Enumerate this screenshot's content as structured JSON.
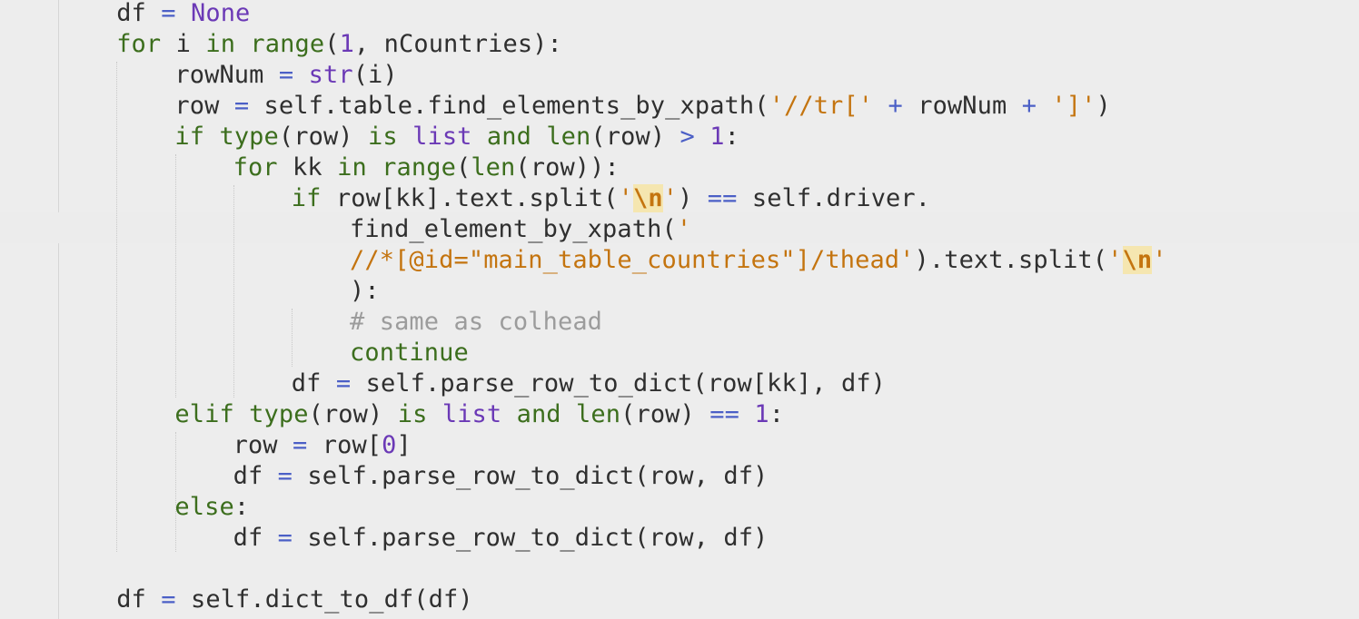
{
  "editor": {
    "language": "python",
    "lines": [
      {
        "indent": "    ",
        "tokens": [
          [
            "id",
            "df"
          ],
          [
            "p",
            " "
          ],
          [
            "op",
            "="
          ],
          [
            "p",
            " "
          ],
          [
            "cls",
            "None"
          ]
        ]
      },
      {
        "indent": "    ",
        "tokens": [
          [
            "kw",
            "for"
          ],
          [
            "p",
            " i "
          ],
          [
            "kw",
            "in"
          ],
          [
            "p",
            " "
          ],
          [
            "bi",
            "range"
          ],
          [
            "p",
            "("
          ],
          [
            "num",
            "1"
          ],
          [
            "p",
            ", nCountries):"
          ]
        ]
      },
      {
        "indent": "        ",
        "tokens": [
          [
            "id",
            "rowNum"
          ],
          [
            "p",
            " "
          ],
          [
            "op",
            "="
          ],
          [
            "p",
            " "
          ],
          [
            "cls",
            "str"
          ],
          [
            "p",
            "(i)"
          ]
        ]
      },
      {
        "indent": "        ",
        "tokens": [
          [
            "id",
            "row"
          ],
          [
            "p",
            " "
          ],
          [
            "op",
            "="
          ],
          [
            "p",
            " self.table.find_elements_by_xpath("
          ],
          [
            "str",
            "'//tr['"
          ],
          [
            "p",
            " "
          ],
          [
            "op",
            "+"
          ],
          [
            "p",
            " rowNum "
          ],
          [
            "op",
            "+"
          ],
          [
            "p",
            " "
          ],
          [
            "str",
            "']'"
          ],
          [
            "p",
            ")"
          ]
        ]
      },
      {
        "indent": "        ",
        "tokens": [
          [
            "kw",
            "if"
          ],
          [
            "p",
            " "
          ],
          [
            "bi",
            "type"
          ],
          [
            "p",
            "(row) "
          ],
          [
            "kw",
            "is"
          ],
          [
            "p",
            " "
          ],
          [
            "cls",
            "list"
          ],
          [
            "p",
            " "
          ],
          [
            "kw",
            "and"
          ],
          [
            "p",
            " "
          ],
          [
            "bi",
            "len"
          ],
          [
            "p",
            "(row) "
          ],
          [
            "op",
            ">"
          ],
          [
            "p",
            " "
          ],
          [
            "num",
            "1"
          ],
          [
            "p",
            ":"
          ]
        ]
      },
      {
        "indent": "            ",
        "tokens": [
          [
            "kw",
            "for"
          ],
          [
            "p",
            " kk "
          ],
          [
            "kw",
            "in"
          ],
          [
            "p",
            " "
          ],
          [
            "bi",
            "range"
          ],
          [
            "p",
            "("
          ],
          [
            "bi",
            "len"
          ],
          [
            "p",
            "(row)):"
          ]
        ]
      },
      {
        "indent": "                ",
        "tokens": [
          [
            "kw",
            "if"
          ],
          [
            "p",
            " row[kk].text.split("
          ],
          [
            "str",
            "'"
          ],
          [
            "esc",
            "\\n"
          ],
          [
            "str",
            "'"
          ],
          [
            "p",
            ") "
          ],
          [
            "op",
            "=="
          ],
          [
            "p",
            " self.driver."
          ]
        ]
      },
      {
        "indent": "                    ",
        "tokens": [
          [
            "p",
            "find_element_by_xpath("
          ],
          [
            "str",
            "'"
          ]
        ]
      },
      {
        "indent": "                    ",
        "tokens": [
          [
            "str",
            "//*[@id=\"main_table_countries\"]/thead'"
          ],
          [
            "p",
            ").text.split("
          ],
          [
            "str",
            "'"
          ],
          [
            "esc",
            "\\n"
          ],
          [
            "str",
            "'"
          ]
        ]
      },
      {
        "indent": "                    ",
        "tokens": [
          [
            "p",
            "):"
          ]
        ]
      },
      {
        "indent": "                    ",
        "tokens": [
          [
            "cmt",
            "# same as colhead"
          ]
        ]
      },
      {
        "indent": "                    ",
        "tokens": [
          [
            "kw",
            "continue"
          ]
        ]
      },
      {
        "indent": "                ",
        "tokens": [
          [
            "id",
            "df"
          ],
          [
            "p",
            " "
          ],
          [
            "op",
            "="
          ],
          [
            "p",
            " self.parse_row_to_dict(row[kk], df)"
          ]
        ]
      },
      {
        "indent": "        ",
        "tokens": [
          [
            "kw",
            "elif"
          ],
          [
            "p",
            " "
          ],
          [
            "bi",
            "type"
          ],
          [
            "p",
            "(row) "
          ],
          [
            "kw",
            "is"
          ],
          [
            "p",
            " "
          ],
          [
            "cls",
            "list"
          ],
          [
            "p",
            " "
          ],
          [
            "kw",
            "and"
          ],
          [
            "p",
            " "
          ],
          [
            "bi",
            "len"
          ],
          [
            "p",
            "(row) "
          ],
          [
            "op",
            "=="
          ],
          [
            "p",
            " "
          ],
          [
            "num",
            "1"
          ],
          [
            "p",
            ":"
          ]
        ]
      },
      {
        "indent": "            ",
        "tokens": [
          [
            "id",
            "row"
          ],
          [
            "p",
            " "
          ],
          [
            "op",
            "="
          ],
          [
            "p",
            " row["
          ],
          [
            "num",
            "0"
          ],
          [
            "p",
            "]"
          ]
        ]
      },
      {
        "indent": "            ",
        "tokens": [
          [
            "id",
            "df"
          ],
          [
            "p",
            " "
          ],
          [
            "op",
            "="
          ],
          [
            "p",
            " self.parse_row_to_dict(row, df)"
          ]
        ]
      },
      {
        "indent": "        ",
        "tokens": [
          [
            "kw",
            "else"
          ],
          [
            "p",
            ":"
          ]
        ]
      },
      {
        "indent": "            ",
        "tokens": [
          [
            "id",
            "df"
          ],
          [
            "p",
            " "
          ],
          [
            "op",
            "="
          ],
          [
            "p",
            " self.parse_row_to_dict(row, df)"
          ]
        ]
      },
      {
        "indent": "",
        "tokens": []
      },
      {
        "indent": "    ",
        "tokens": [
          [
            "id",
            "df"
          ],
          [
            "p",
            " "
          ],
          [
            "op",
            "="
          ],
          [
            "p",
            " self.dict_to_df(df)"
          ]
        ]
      }
    ]
  }
}
